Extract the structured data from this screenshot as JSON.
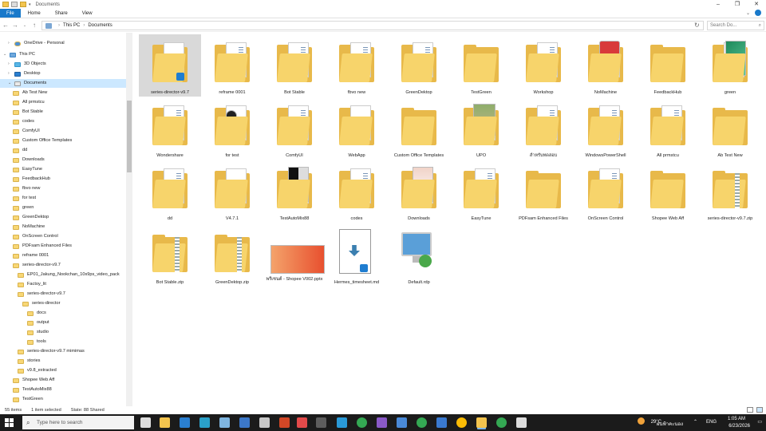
{
  "window": {
    "title": "Documents"
  },
  "ribbon": {
    "tabs": [
      "File",
      "Home",
      "Share",
      "View"
    ]
  },
  "address": {
    "crumbs": [
      "This PC",
      "Documents"
    ],
    "search_placeholder": "Search Do..."
  },
  "nav": {
    "items": [
      {
        "label": "OneDrive - Personal",
        "icon": "cloud",
        "indent": 1,
        "chev": ">"
      },
      {
        "label": "This PC",
        "icon": "pc",
        "indent": 0,
        "chev": "v"
      },
      {
        "label": "3D Objects",
        "icon": "cube",
        "indent": 1,
        "chev": ">"
      },
      {
        "label": "Desktop",
        "icon": "desk",
        "indent": 1,
        "chev": ">"
      },
      {
        "label": "Documents",
        "icon": "doc",
        "indent": 1,
        "chev": "v",
        "selected": true
      },
      {
        "label": "Ab Test New",
        "icon": "folder",
        "indent": 2
      },
      {
        "label": "All prmstcu",
        "icon": "folder",
        "indent": 2
      },
      {
        "label": "Bot Stable",
        "icon": "folder",
        "indent": 2
      },
      {
        "label": "codes",
        "icon": "folder",
        "indent": 2
      },
      {
        "label": "ComfyUI",
        "icon": "folder",
        "indent": 2
      },
      {
        "label": "Custom Office Templates",
        "icon": "folder",
        "indent": 2
      },
      {
        "label": "dd",
        "icon": "folder",
        "indent": 2
      },
      {
        "label": "Downloads",
        "icon": "folder",
        "indent": 2
      },
      {
        "label": "EasyTune",
        "icon": "folder",
        "indent": 2
      },
      {
        "label": "FeedbackHub",
        "icon": "folder",
        "indent": 2
      },
      {
        "label": "fbvo new",
        "icon": "folder",
        "indent": 2
      },
      {
        "label": "for test",
        "icon": "folder",
        "indent": 2
      },
      {
        "label": "green",
        "icon": "folder",
        "indent": 2
      },
      {
        "label": "GreenDektop",
        "icon": "folder",
        "indent": 2
      },
      {
        "label": "NoMachine",
        "icon": "folder",
        "indent": 2
      },
      {
        "label": "OnScreen Control",
        "icon": "folder",
        "indent": 2
      },
      {
        "label": "PDFsam Enhanced Files",
        "icon": "folder",
        "indent": 2
      },
      {
        "label": "reframe 0001",
        "icon": "folder",
        "indent": 2
      },
      {
        "label": "series-director-v9.7",
        "icon": "folder",
        "indent": 2
      },
      {
        "label": "EP01_Jakung_Nookchan_10s9ps_video_pack",
        "icon": "folder",
        "indent": 3
      },
      {
        "label": "Factoy_lit",
        "icon": "folder",
        "indent": 3
      },
      {
        "label": "series-director-v9.7",
        "icon": "folder",
        "indent": 3
      },
      {
        "label": "series-director",
        "icon": "folder",
        "indent": 4
      },
      {
        "label": "docs",
        "icon": "folder",
        "indent": 5
      },
      {
        "label": "output",
        "icon": "folder",
        "indent": 5
      },
      {
        "label": "studio",
        "icon": "folder",
        "indent": 5
      },
      {
        "label": "tools",
        "icon": "folder",
        "indent": 5
      },
      {
        "label": "series-director-v9.7 mimimas",
        "icon": "folder",
        "indent": 3
      },
      {
        "label": "stories",
        "icon": "folder",
        "indent": 3
      },
      {
        "label": "v9.8_extracted",
        "icon": "folder",
        "indent": 3
      },
      {
        "label": "Shopee Web Aff",
        "icon": "folder",
        "indent": 2
      },
      {
        "label": "TestAutoMix88",
        "icon": "folder",
        "indent": 2
      },
      {
        "label": "TestGreen",
        "icon": "folder",
        "indent": 2
      }
    ]
  },
  "files": [
    {
      "name": "series-director-v9.7",
      "kind": "folder-vsc",
      "selected": true
    },
    {
      "name": "reframe 0001",
      "kind": "folder-paper"
    },
    {
      "name": "Bot Stable",
      "kind": "folder-paper"
    },
    {
      "name": "fbvo new",
      "kind": "folder-paper"
    },
    {
      "name": "GreenDektop",
      "kind": "folder-paper"
    },
    {
      "name": "TestGreen",
      "kind": "folder"
    },
    {
      "name": "Workshop",
      "kind": "folder-paper"
    },
    {
      "name": "NoMachine",
      "kind": "folder-red"
    },
    {
      "name": "FeedbackHub",
      "kind": "folder"
    },
    {
      "name": "green",
      "kind": "folder-green"
    },
    {
      "name": "Wondershare",
      "kind": "folder-paper"
    },
    {
      "name": "for test",
      "kind": "folder-media"
    },
    {
      "name": "ComfyUI",
      "kind": "folder-paper"
    },
    {
      "name": "WebApp",
      "kind": "folder-doc"
    },
    {
      "name": "Custom Office Templates",
      "kind": "folder"
    },
    {
      "name": "UPO",
      "kind": "folder-photo"
    },
    {
      "name": "สำหรับทดสอบ",
      "kind": "folder-paper"
    },
    {
      "name": "WindowsPowerShell",
      "kind": "folder-paper"
    },
    {
      "name": "All prmstcu",
      "kind": "folder-paper"
    },
    {
      "name": "Ab Test New",
      "kind": "folder"
    },
    {
      "name": "dd",
      "kind": "folder-paper"
    },
    {
      "name": "V4.7.1",
      "kind": "folder-doc"
    },
    {
      "name": "TestAutoMix88",
      "kind": "folder-bw"
    },
    {
      "name": "codes",
      "kind": "folder-paper"
    },
    {
      "name": "Downloads",
      "kind": "folder-pink"
    },
    {
      "name": "EasyTune",
      "kind": "folder-paper"
    },
    {
      "name": "PDFsam Enhanced Files",
      "kind": "folder"
    },
    {
      "name": "OnScreen Control",
      "kind": "folder-paper"
    },
    {
      "name": "Shopee Web Aff",
      "kind": "folder"
    },
    {
      "name": "series-director-v9.7.zip",
      "kind": "zip"
    },
    {
      "name": "Bot Stable.zip",
      "kind": "zip"
    },
    {
      "name": "GreenDektop.zip",
      "kind": "zip"
    },
    {
      "name": "พรีเซนต์ - Shopee V002.pptx",
      "kind": "pptx"
    },
    {
      "name": "Hermes_timesheet.md",
      "kind": "md"
    },
    {
      "name": "Default.rdp",
      "kind": "rdp"
    }
  ],
  "status": {
    "count": "55 items",
    "selected": "1 item selected",
    "state": "State: 88 Shared"
  },
  "taskbar": {
    "search_placeholder": "Type here to search",
    "weather": "29°C",
    "weather_text": "ฝนฟ้าคะนอง",
    "lang": "ENG",
    "time": "1:05 AM",
    "date": "6/23/2026"
  },
  "colors": {
    "accent": "#1979ca",
    "folder": "#f7d46b",
    "selection": "#cce8ff",
    "taskbar": "#1b1b1b"
  }
}
